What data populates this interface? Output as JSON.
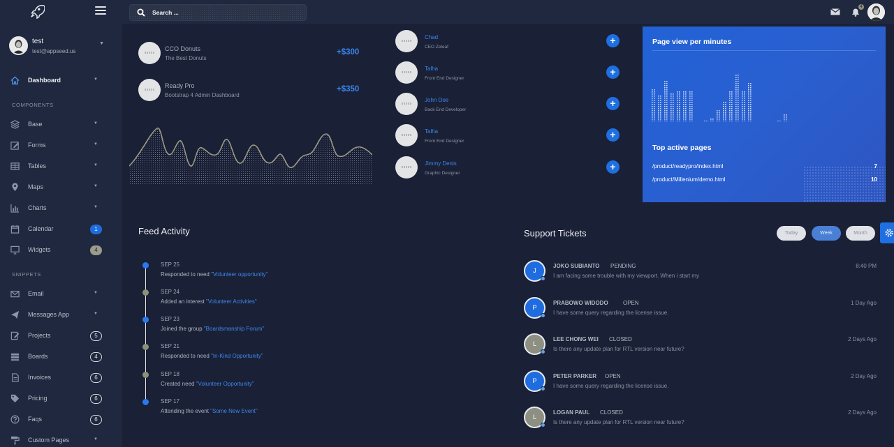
{
  "sidebar": {
    "user": {
      "name": "test",
      "email": "test@appseed.us"
    },
    "sections": {
      "components": "COMPONENTS",
      "snippets": "SNIPPETS"
    },
    "items": [
      {
        "label": "Dashboard",
        "icon": "home-icon"
      },
      {
        "label": "Base",
        "icon": "layers-icon"
      },
      {
        "label": "Forms",
        "icon": "pen-square-icon"
      },
      {
        "label": "Tables",
        "icon": "table-icon"
      },
      {
        "label": "Maps",
        "icon": "map-marker-icon"
      },
      {
        "label": "Charts",
        "icon": "chart-icon"
      },
      {
        "label": "Calendar",
        "icon": "calendar-icon",
        "badge": "1"
      },
      {
        "label": "Widgets",
        "icon": "desktop-icon",
        "badge": "4"
      },
      {
        "label": "Email",
        "icon": "envelope-icon"
      },
      {
        "label": "Messages App",
        "icon": "paper-plane-icon"
      },
      {
        "label": "Projects",
        "icon": "projects-icon",
        "badge": "5"
      },
      {
        "label": "Boards",
        "icon": "boards-icon",
        "badge": "4"
      },
      {
        "label": "Invoices",
        "icon": "invoice-icon",
        "badge": "6"
      },
      {
        "label": "Pricing",
        "icon": "tags-icon",
        "badge": "6"
      },
      {
        "label": "Faqs",
        "icon": "question-icon",
        "badge": "6"
      },
      {
        "label": "Custom Pages",
        "icon": "paint-roller-icon"
      }
    ]
  },
  "topbar": {
    "search_placeholder": "Search ...",
    "notification_count": "4"
  },
  "transactions": [
    {
      "name": "CCO Donuts",
      "subtitle": "The Best Donuts",
      "amount": "+$300"
    },
    {
      "name": "Ready Pro",
      "subtitle": "Bootstrap 4 Admin Dashboard",
      "amount": "+$350"
    }
  ],
  "people": [
    {
      "name": "Chad",
      "role": "CEO Zeleaf"
    },
    {
      "name": "Talha",
      "role": "Front End Designer"
    },
    {
      "name": "John Doe",
      "role": "Back End Developer"
    },
    {
      "name": "Talha",
      "role": "Front End Designer"
    },
    {
      "name": "Jimmy Denis",
      "role": "Graphic Designer"
    }
  ],
  "page_views": {
    "title": "Page view per minutes",
    "bars": [
      62,
      52,
      78,
      56,
      60,
      58,
      58,
      4,
      6,
      22,
      40,
      58,
      90,
      60,
      76,
      4,
      14
    ],
    "active_title": "Top active pages",
    "pages": [
      {
        "url": "/product/readypro/index.html",
        "count": "7"
      },
      {
        "url": "/product/Millenium/demo.html",
        "count": "10"
      }
    ]
  },
  "feed": {
    "title": "Feed Activity",
    "items": [
      {
        "date": "SEP 25",
        "text": "Responded to need ",
        "link": "\"Volunteer opportunity\"",
        "color": "blue"
      },
      {
        "date": "SEP 24",
        "text": "Added an interest ",
        "link": "\"Volunteer Activities\"",
        "color": "olive"
      },
      {
        "date": "SEP 23",
        "text": "Joined the group ",
        "link": "\"Boardsmanship Forum\"",
        "color": "blue"
      },
      {
        "date": "SEP 21",
        "text": "Responded to need ",
        "link": "\"In-Kind Opportunity\"",
        "color": "olive"
      },
      {
        "date": "SEP 18",
        "text": "Created need ",
        "link": "\"Volunteer Opportunity\"",
        "color": "olive"
      },
      {
        "date": "SEP 17",
        "text": "Attending the event ",
        "link": "\"Some New Event\"",
        "color": "blue"
      }
    ]
  },
  "tickets": {
    "title": "Support Tickets",
    "filters": [
      "Today",
      "Week",
      "Month"
    ],
    "items": [
      {
        "initial": "J",
        "name": "JOKO SUBIANTO",
        "status": "PENDING",
        "message": "I am facing some trouble with my viewport. When i start my",
        "time": "8:40 PM",
        "color": "blue"
      },
      {
        "initial": "P",
        "name": "PRABOWO WIDODO",
        "status": "OPEN",
        "message": "I have some query regarding the license issue.",
        "time": "1 Day Ago",
        "color": "blue"
      },
      {
        "initial": "L",
        "name": "LEE CHONG WEI",
        "status": "CLOSED",
        "message": "Is there any update plan for RTL version near future?",
        "time": "2 Days Ago",
        "color": "gray"
      },
      {
        "initial": "P",
        "name": "PETER PARKER",
        "status": "OPEN",
        "message": "I have some query regarding the license issue.",
        "time": "2 Day Ago",
        "color": "blue"
      },
      {
        "initial": "L",
        "name": "LOGAN PAUL",
        "status": "CLOSED",
        "message": "Is there any update plan for RTL version near future?",
        "time": "2 Days Ago",
        "color": "gray"
      }
    ]
  },
  "colors": {
    "accent": "#1e6ce0",
    "background": "#1a2035",
    "sidebar": "#1f283e",
    "card_blue": "#2162d6"
  }
}
